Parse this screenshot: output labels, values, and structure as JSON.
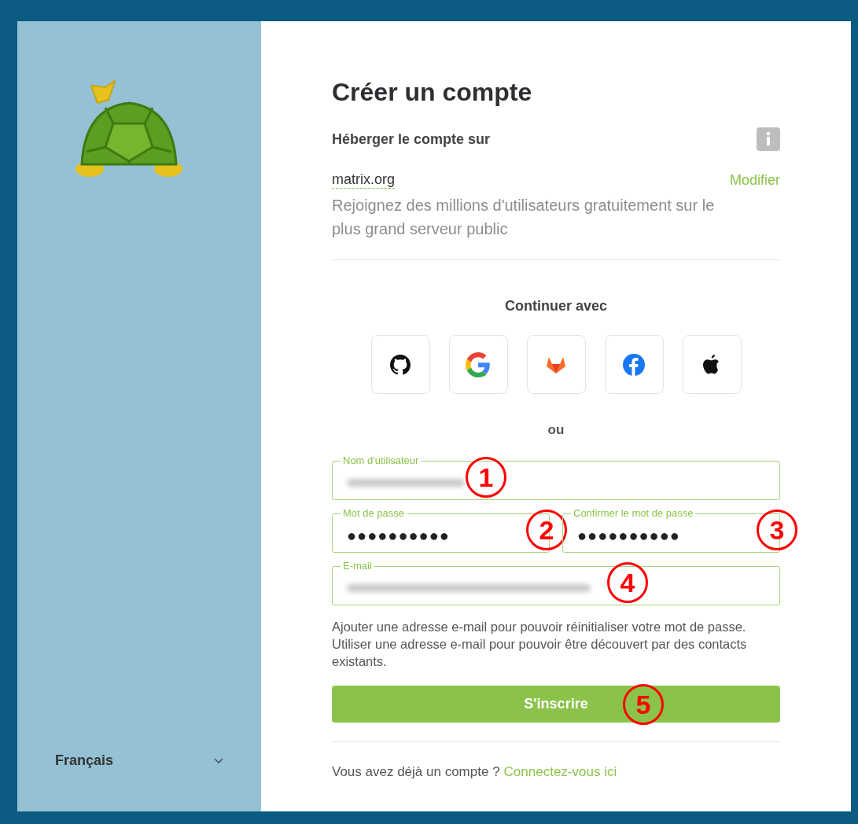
{
  "sidebar": {
    "language": "Français"
  },
  "title": "Créer un compte",
  "server": {
    "heading": "Héberger le compte sur",
    "name": "matrix.org",
    "change_link": "Modifier",
    "description": "Rejoignez des millions d'utilisateurs gratuitement sur le plus grand serveur public"
  },
  "sso": {
    "heading": "Continuer avec",
    "providers": [
      {
        "kind": "github"
      },
      {
        "kind": "google"
      },
      {
        "kind": "gitlab"
      },
      {
        "kind": "facebook"
      },
      {
        "kind": "apple"
      }
    ]
  },
  "separator": "ou",
  "fields": [
    {
      "label": "Nom d'utilisateur",
      "kind": "text",
      "blurred": true,
      "annotation": "1"
    },
    {
      "label": "Mot de passe",
      "kind": "password",
      "value": "●●●●●●●●●●",
      "annotation": "2"
    },
    {
      "label": "Confirmer le mot de passe",
      "kind": "password",
      "value": "●●●●●●●●●●",
      "annotation": "3"
    },
    {
      "label": "E-mail",
      "kind": "text",
      "blurred": true,
      "annotation": "4"
    }
  ],
  "email_help": "Ajouter une adresse e-mail pour pouvoir réinitialiser votre mot de passe. Utiliser une adresse e-mail pour pouvoir être découvert par des contacts existants.",
  "submit": {
    "label": "S'inscrire",
    "annotation": "5"
  },
  "footer": {
    "text": "Vous avez déjà un compte ?",
    "link": "Connectez-vous ici"
  }
}
